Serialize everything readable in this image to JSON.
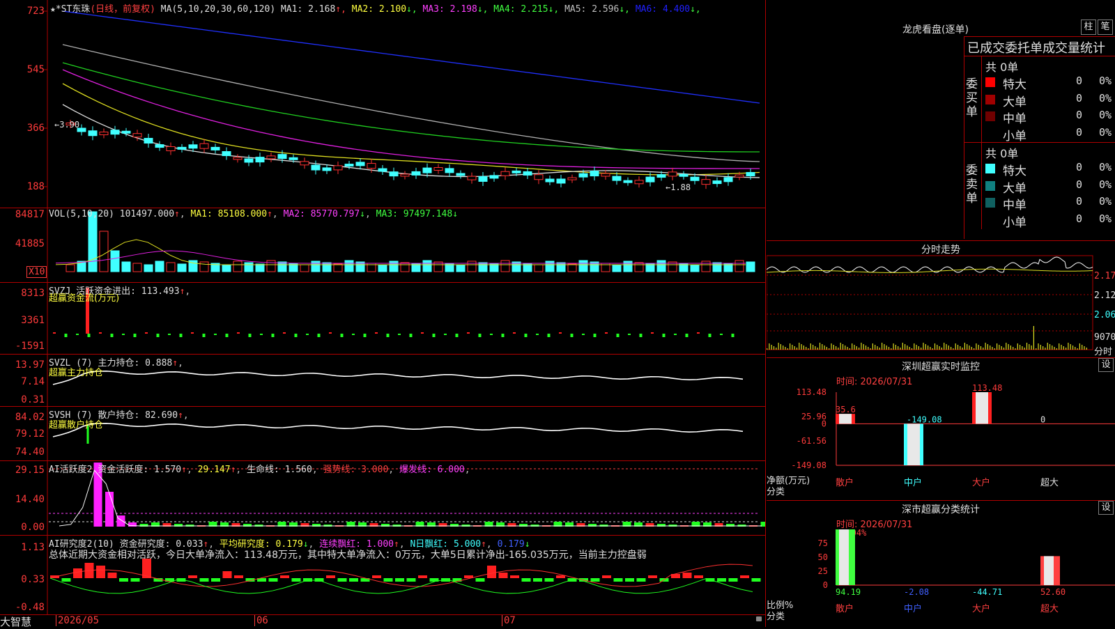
{
  "stock": {
    "star_mark": "★",
    "name": "*ST东珠",
    "period": "(日线，前复权)"
  },
  "price_chart": {
    "ma_label": "MA(5,10,20,30,60,120)",
    "ma": [
      {
        "label": "MA1: 2.168",
        "arrow": "↑",
        "color": "#e0e0e0"
      },
      {
        "label": "MA2: 2.100",
        "arrow": "↓",
        "color": "#ffff40"
      },
      {
        "label": "MA3: 2.198",
        "arrow": "↓",
        "color": "#ff40ff"
      },
      {
        "label": "MA4: 2.215",
        "arrow": "↓",
        "color": "#40ff40"
      },
      {
        "label": "MA5: 2.596",
        "arrow": "↓",
        "color": "#c0c0c0"
      },
      {
        "label": "MA6: 4.400",
        "arrow": "↓",
        "color": "#2020ff"
      }
    ],
    "y_ticks": [
      "723",
      "545",
      "366",
      "188"
    ],
    "high_mark": "←3.90",
    "low_mark": "←1.88"
  },
  "volume": {
    "label": "VOL(5,10,20)",
    "value": "101497.000",
    "ma1": "MA1: 85108.000",
    "ma2": "MA2: 85770.797",
    "ma3": "MA3: 97497.148",
    "y_ticks": [
      "84817",
      "41885"
    ],
    "unit": "X10"
  },
  "svzj": {
    "label": "SVZJ",
    "title": "活跃资金进出: 113.493",
    "sub": "超赢资金流(万元)",
    "y_ticks": [
      "8313",
      "3361",
      "-1591"
    ]
  },
  "svzl": {
    "label": "SVZL (7)",
    "title": "主力持仓: 0.888",
    "sub": "超赢主力持仓",
    "y_ticks": [
      "13.97",
      "7.14",
      "0.31"
    ]
  },
  "svsh": {
    "label": "SVSH (7)",
    "title": "散户持仓: 82.690",
    "sub": "超赢散户持仓",
    "y_ticks": [
      "84.02",
      "79.12",
      "74.40"
    ]
  },
  "ai_active": {
    "label": "AI活跃度2",
    "title": "资金活跃度: 1.570",
    "v2": "29.147",
    "life": "生命线: 1.560",
    "strong": "强势线: 3.000",
    "burst": "爆发线: 6.000",
    "y_ticks": [
      "29.15",
      "14.40",
      "0.00"
    ]
  },
  "ai_research": {
    "label": "AI研究度2(10)",
    "title": "资金研究度: 0.033",
    "avg": "平均研究度: 0.179",
    "red": "连续飘红: 1.000",
    "nred": "N日飘红: 5.000",
    "v5": "0.179",
    "summary": "总体近期大资金相对活跃，今日大单净流入：113.48万元，其中特大单净流入：0万元，大单5日累计净出-165.035万元，当前主力控盘弱",
    "y_ticks": [
      "1.13",
      "0.33",
      "-0.48"
    ]
  },
  "x_axis": {
    "labels": [
      "2026/05",
      "06",
      "07"
    ],
    "brand": "大智慧"
  },
  "right": {
    "dragon_title": "龙虎看盘(逐单)",
    "btn_zhu": "柱",
    "btn_bi": "笔",
    "stats_title": "已成交委托单成交量统计",
    "buy": {
      "side": "委买单",
      "total": "共 0单",
      "rows": [
        {
          "name": "特大",
          "qty": "0",
          "pct": "0%",
          "color": "#ff0000"
        },
        {
          "name": "大单",
          "qty": "0",
          "pct": "0%",
          "color": "#a00000"
        },
        {
          "name": "中单",
          "qty": "0",
          "pct": "0%",
          "color": "#700000"
        },
        {
          "name": "小单",
          "qty": "0",
          "pct": "0%",
          "color": ""
        }
      ]
    },
    "sell": {
      "side": "委卖单",
      "total": "共 0单",
      "rows": [
        {
          "name": "特大",
          "qty": "0",
          "pct": "0%",
          "color": "#40ffff"
        },
        {
          "name": "大单",
          "qty": "0",
          "pct": "0%",
          "color": "#108080"
        },
        {
          "name": "中单",
          "qty": "0",
          "pct": "0%",
          "color": "#106060"
        },
        {
          "name": "小单",
          "qty": "0",
          "pct": "0%",
          "color": ""
        }
      ]
    },
    "intraday": {
      "title": "分时走势",
      "prices": [
        "2.175",
        "2.120",
        "2.065"
      ],
      "vol": "9070",
      "vol_label": "分时"
    },
    "monitor": {
      "title": "深圳超赢实时监控",
      "set": "设",
      "time": "时间: 2026/07/31",
      "y_ticks": [
        "113.48",
        "25.96",
        "0",
        "-61.56",
        "-149.08"
      ],
      "ylabel": "净额(万元)",
      "cat_label": "分类",
      "bars": [
        {
          "cat": "散户",
          "value": 35.6,
          "label": "35.6",
          "cat_color": "#ff4040"
        },
        {
          "cat": "中户",
          "value": -149.08,
          "label": "-149.08",
          "cat_color": "#40ffff"
        },
        {
          "cat": "大户",
          "value": 113.48,
          "label": "113.48",
          "cat_color": "#ff4040"
        },
        {
          "cat": "超大",
          "value": 0,
          "label": "0",
          "cat_color": "#e0e0e0"
        }
      ]
    },
    "classify": {
      "title": "深市超赢分类统计",
      "set": "设",
      "time": "时间: 2026/07/31",
      "top": "+0.04%",
      "y_ticks": [
        "75",
        "50",
        "25",
        "0"
      ],
      "ylabel": "比例%",
      "cat_label": "分类",
      "bars": [
        {
          "cat": "散户",
          "pct": 100,
          "value": "94.19",
          "color": "#40ff40",
          "cat_color": "#ff4040"
        },
        {
          "cat": "中户",
          "pct": 0,
          "value": "-2.08",
          "color": "#4060ff",
          "cat_color": "#4060ff"
        },
        {
          "cat": "大户",
          "pct": 0,
          "value": "-44.71",
          "color": "#40ffff",
          "cat_color": "#ff4040"
        },
        {
          "cat": "超大",
          "pct": 52,
          "value": "52.60",
          "color": "#ff4040",
          "cat_color": "#ff4040"
        }
      ]
    }
  },
  "chart_data": [
    {
      "type": "line",
      "title": "*ST东珠 日线",
      "series": [
        {
          "name": "MA1",
          "values": [
            3.7,
            3.55,
            3.4,
            3.2,
            3.05,
            2.9,
            2.75,
            2.6,
            2.5,
            2.45,
            2.4,
            2.38,
            2.36,
            2.33,
            2.3,
            2.25,
            2.2,
            2.16,
            2.14,
            2.12,
            2.1,
            2.08,
            2.06,
            2.03,
            2.0,
            1.98,
            1.97,
            1.99,
            2.06,
            2.12,
            2.1,
            2.08,
            2.04,
            2.0,
            2.0,
            2.02,
            2.05,
            2.1,
            2.14,
            2.17
          ]
        },
        {
          "name": "MA6",
          "values": [
            6.9,
            6.8,
            6.7,
            6.6,
            6.5,
            6.4,
            6.3,
            6.2,
            6.1,
            6.0,
            5.9,
            5.8,
            5.7,
            5.6,
            5.5,
            5.4,
            5.3,
            5.2,
            5.1,
            5.0,
            4.9,
            4.8,
            4.7,
            4.6,
            4.5,
            4.4
          ]
        }
      ]
    }
  ]
}
